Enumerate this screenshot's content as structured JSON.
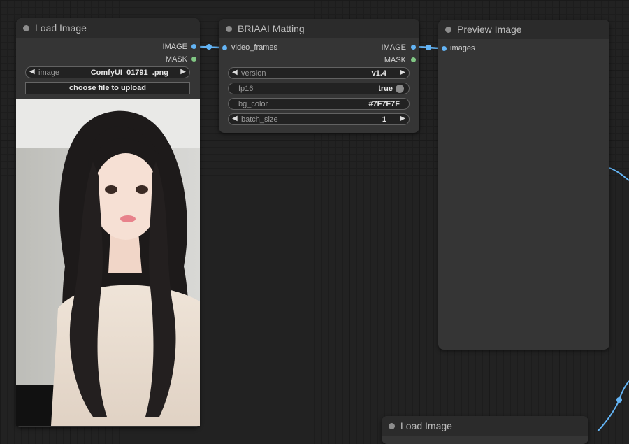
{
  "nodes": {
    "load_image": {
      "title": "Load Image",
      "outputs": [
        "IMAGE",
        "MASK"
      ],
      "image_widget": {
        "label": "image",
        "value": "ComfyUI_01791_.png"
      },
      "upload_label": "choose file to upload"
    },
    "briaai_matting": {
      "title": "BRIAAI Matting",
      "input": "video_frames",
      "outputs": [
        "IMAGE",
        "MASK"
      ],
      "widgets": [
        {
          "label": "version",
          "value": "v1.4"
        },
        {
          "label": "fp16",
          "value": "true"
        },
        {
          "label": "bg_color",
          "value": "#7F7F7F"
        },
        {
          "label": "batch_size",
          "value": "1"
        }
      ]
    },
    "preview_image": {
      "title": "Preview Image",
      "input": "images"
    },
    "load_image_2": {
      "title": "Load Image"
    }
  },
  "colors": {
    "image_socket": "#64b5f6",
    "mask_socket": "#81c784",
    "wire": "#64b5f6",
    "canvas": "#222222"
  }
}
